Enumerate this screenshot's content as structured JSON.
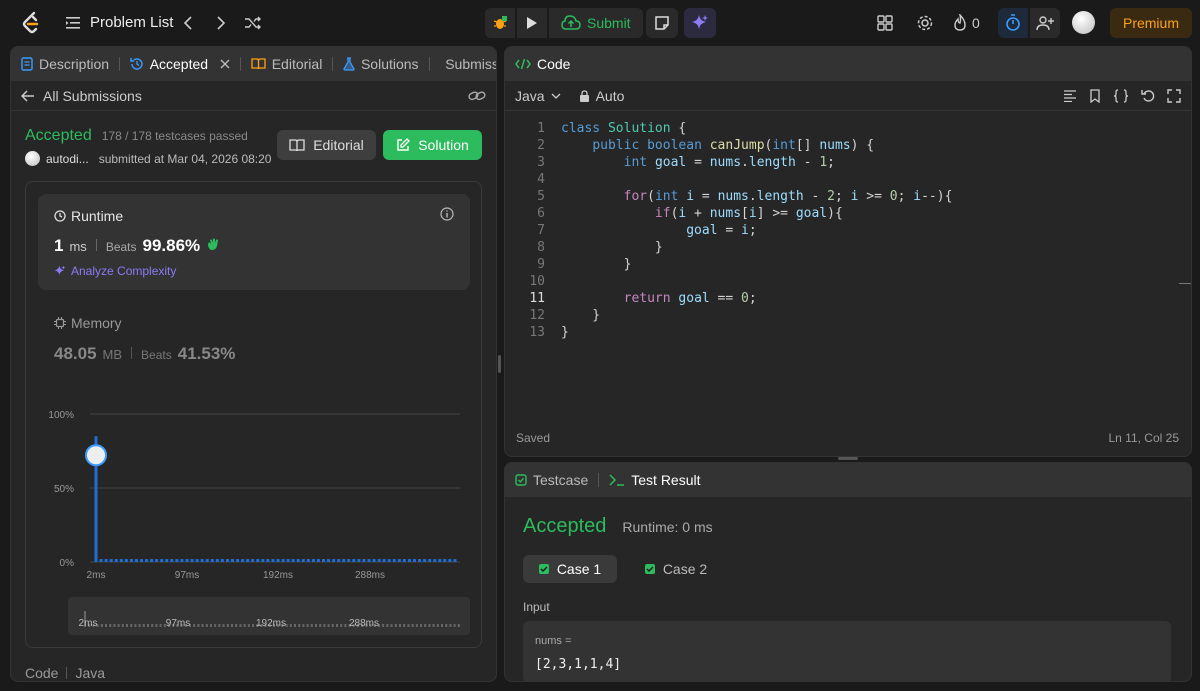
{
  "topbar": {
    "problem_list": "Problem List",
    "submit": "Submit",
    "streak": "0",
    "premium": "Premium"
  },
  "left": {
    "tabs": [
      "Description",
      "Accepted",
      "Editorial",
      "Solutions",
      "Submissions"
    ],
    "back": "All Submissions",
    "status": "Accepted",
    "testcases": "178 / 178 testcases passed",
    "user": "autodi...",
    "submitted": "submitted at Mar 04, 2026 08:20",
    "editorial_btn": "Editorial",
    "solution_btn": "Solution",
    "runtime_title": "Runtime",
    "runtime_value": "1",
    "runtime_unit": "ms",
    "beats_label": "Beats",
    "runtime_beats": "99.86%",
    "analyze": "Analyze Complexity",
    "memory_title": "Memory",
    "memory_value": "48.05",
    "memory_unit": "MB",
    "memory_beats": "41.53%",
    "footer_code": "Code",
    "footer_lang": "Java"
  },
  "chart_data": {
    "type": "bar",
    "y_ticks": [
      "100%",
      "50%",
      "0%"
    ],
    "x_ticks": [
      "2ms",
      "97ms",
      "192ms",
      "288ms"
    ],
    "ylim": [
      0,
      100
    ],
    "highlight_value": 85,
    "baseline_value": 2,
    "bar_count": 72,
    "mini_ticks": [
      "2ms",
      "97ms",
      "192ms",
      "288ms"
    ]
  },
  "editor": {
    "title": "Code",
    "language": "Java",
    "mode": "Auto",
    "status": "Saved",
    "cursor": "Ln 11, Col 25",
    "line_numbers": [
      "1",
      "2",
      "3",
      "4",
      "5",
      "6",
      "7",
      "8",
      "9",
      "10",
      "11",
      "12",
      "13"
    ]
  },
  "bottom": {
    "tab_testcase": "Testcase",
    "tab_result": "Test Result",
    "status": "Accepted",
    "runtime": "Runtime: 0 ms",
    "case1": "Case 1",
    "case2": "Case 2",
    "input_label": "Input",
    "var_name": "nums =",
    "var_value": "[2,3,1,1,4]"
  }
}
